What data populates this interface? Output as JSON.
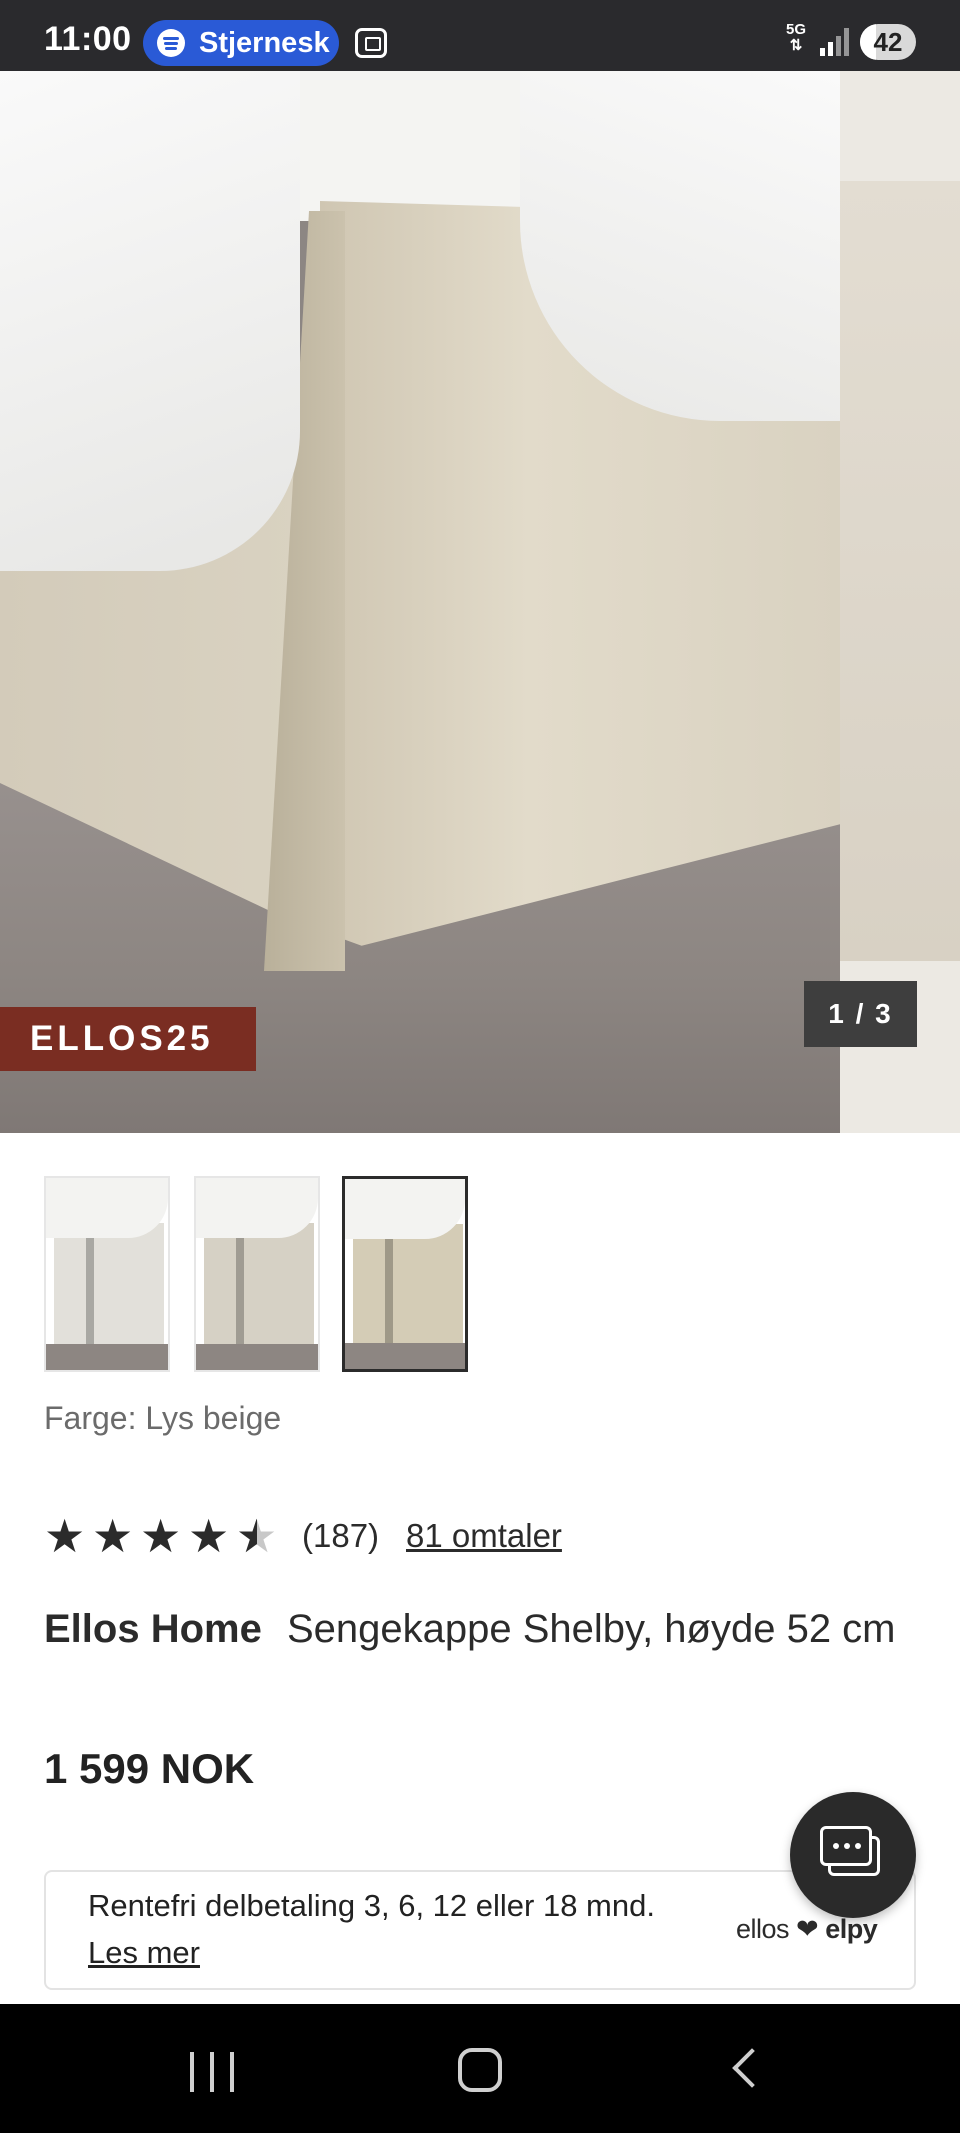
{
  "status_bar": {
    "time": "11:00",
    "media_text": "Stjernesk",
    "network": "5G",
    "battery": "42"
  },
  "gallery": {
    "promo_badge": "ELLOS25",
    "counter": "1 / 3",
    "thumbnail_colors": [
      "#e2e0da",
      "#d6d1c5",
      "#d4ccb6"
    ],
    "selected_thumbnail": 3
  },
  "product": {
    "color_label": "Farge: Lys beige",
    "rating_value": 4.5,
    "rating_count": "(187)",
    "reviews_link": "81 omtaler",
    "brand": "Ellos Home",
    "name": "Sengekappe Shelby, høyde 52 cm",
    "price": "1 599 NOK"
  },
  "installment": {
    "text": "Rentefri delbetaling 3, 6, 12 eller 18 mnd.",
    "link": "Les mer",
    "partner_left": "ellos",
    "partner_heart": "❤",
    "partner_right": "elpy"
  },
  "icons": {
    "chat": "chat-bubbles-icon",
    "star": "star-icon"
  },
  "colors": {
    "status_bar": "#2a2a2d",
    "media_pill": "#2a5ad6",
    "promo_badge": "#7a2d22",
    "counter_badge": "#3e3e3e",
    "chat_button": "#2a2a2a"
  }
}
